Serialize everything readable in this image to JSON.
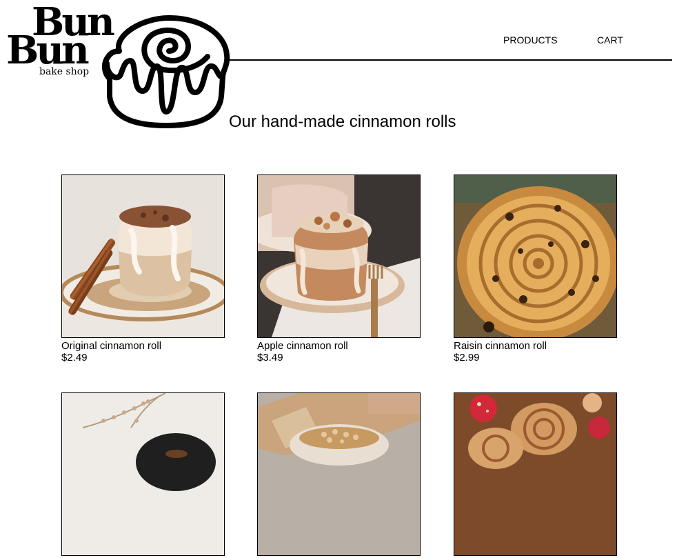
{
  "brand": {
    "name_line1": "Bun",
    "name_line2": "Bun",
    "tagline": "bake shop",
    "logo_icon": "cinnamon-roll-icon"
  },
  "nav": {
    "products_label": "PRODUCTS",
    "cart_label": "CART"
  },
  "main": {
    "title": "Our hand-made cinnamon rolls"
  },
  "products": [
    {
      "name": "Original cinnamon roll",
      "price": "$2.49"
    },
    {
      "name": "Apple cinnamon roll",
      "price": "$3.49"
    },
    {
      "name": "Raisin cinnamon roll",
      "price": "$2.99"
    },
    {
      "name": "",
      "price": ""
    },
    {
      "name": "",
      "price": ""
    },
    {
      "name": "",
      "price": ""
    }
  ]
}
